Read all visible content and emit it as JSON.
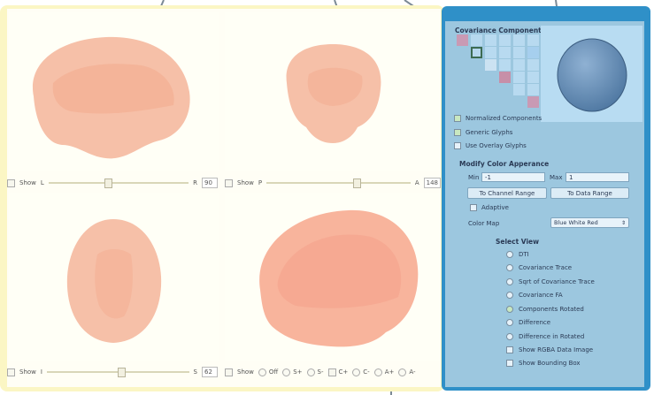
{
  "views": {
    "sagittal": {
      "show": "Show",
      "left": "L",
      "right": "R",
      "value": "90",
      "slider_fraction": 0.4
    },
    "coronal": {
      "show": "Show",
      "left": "P",
      "right": "A",
      "value": "148",
      "slider_fraction": 0.6
    },
    "axial": {
      "show": "Show",
      "left": "I",
      "right": "S",
      "value": "62",
      "slider_fraction": 0.5
    },
    "render3d": {
      "show": "Show",
      "options": [
        "Off",
        "S+",
        "S-",
        "C+",
        "C-",
        "A+",
        "A-"
      ]
    }
  },
  "panel": {
    "title": "Covariance Components",
    "collapse": "^",
    "checkboxes": [
      {
        "label": "Normalized Components",
        "checked": true
      },
      {
        "label": "Generic Glyphs",
        "checked": true
      },
      {
        "label": "Use Overlay Glyphs",
        "checked": false
      }
    ],
    "color_section": "Modify Color Apperance",
    "min_label": "Min",
    "min_value": "-1",
    "max_label": "Max",
    "max_value": "1",
    "to_channel_range": "To Channel Range",
    "to_data_range": "To Data Range",
    "adaptive": "Adaptive",
    "color_map_label": "Color Map",
    "color_map_value": "Blue White Red",
    "select_view_title": "Select View",
    "view_options": [
      {
        "label": "DTI",
        "type": "radio",
        "selected": false
      },
      {
        "label": "Covariance Trace",
        "type": "radio",
        "selected": false
      },
      {
        "label": "Sqrt of Covariance Trace",
        "type": "radio",
        "selected": false
      },
      {
        "label": "Covariance FA",
        "type": "radio",
        "selected": false
      },
      {
        "label": "Components Rotated",
        "type": "radio",
        "selected": true
      },
      {
        "label": "Difference",
        "type": "radio",
        "selected": false
      },
      {
        "label": "Difference in Rotated",
        "type": "radio",
        "selected": false
      },
      {
        "label": "Show RGBA Data Image",
        "type": "checkbox",
        "selected": false
      },
      {
        "label": "Show Bounding Box",
        "type": "checkbox",
        "selected": false
      }
    ]
  },
  "colors": {
    "brain": "#f5b8a0",
    "highlight_left": "#fbf6c4",
    "highlight_right": "#2f90c8",
    "glyph": "#5b84ad"
  }
}
